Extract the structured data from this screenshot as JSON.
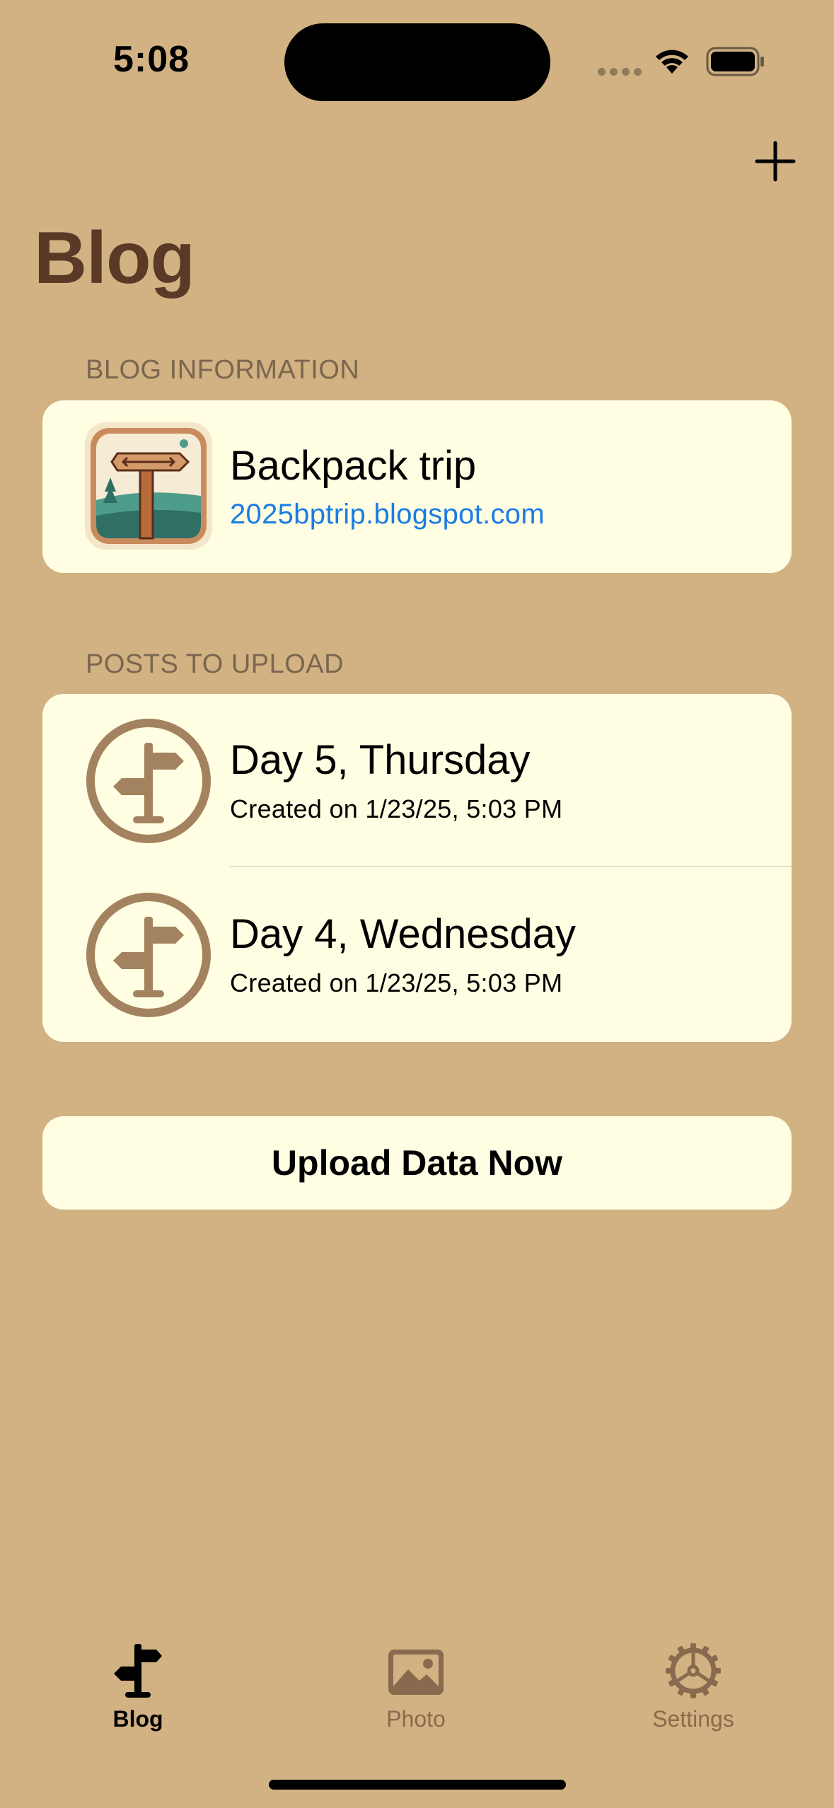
{
  "status_bar": {
    "time": "5:08"
  },
  "nav": {
    "title": "Blog",
    "add_icon": "plus-icon"
  },
  "blog_info": {
    "section_label": "BLOG INFORMATION",
    "name": "Backpack trip",
    "url": "2025bptrip.blogspot.com"
  },
  "posts": {
    "section_label": "POSTS TO UPLOAD",
    "items": [
      {
        "title": "Day 5, Thursday",
        "created": "Created on 1/23/25, 5:03 PM",
        "icon": "signpost-icon"
      },
      {
        "title": "Day 4, Wednesday",
        "created": "Created on 1/23/25, 5:03 PM",
        "icon": "signpost-icon"
      }
    ]
  },
  "upload_button": {
    "label": "Upload Data Now"
  },
  "tab_bar": {
    "tabs": [
      {
        "label": "Blog",
        "icon": "signpost-icon",
        "selected": true
      },
      {
        "label": "Photo",
        "icon": "photo-icon",
        "selected": false
      },
      {
        "label": "Settings",
        "icon": "gear-icon",
        "selected": false
      }
    ]
  },
  "colors": {
    "background": "#D2B282",
    "card": "#FFFDE2",
    "title": "#5A3A26",
    "link": "#1A7CE6",
    "icon_brown": "#A3825F",
    "tab_inactive": "#8A6A4E"
  }
}
